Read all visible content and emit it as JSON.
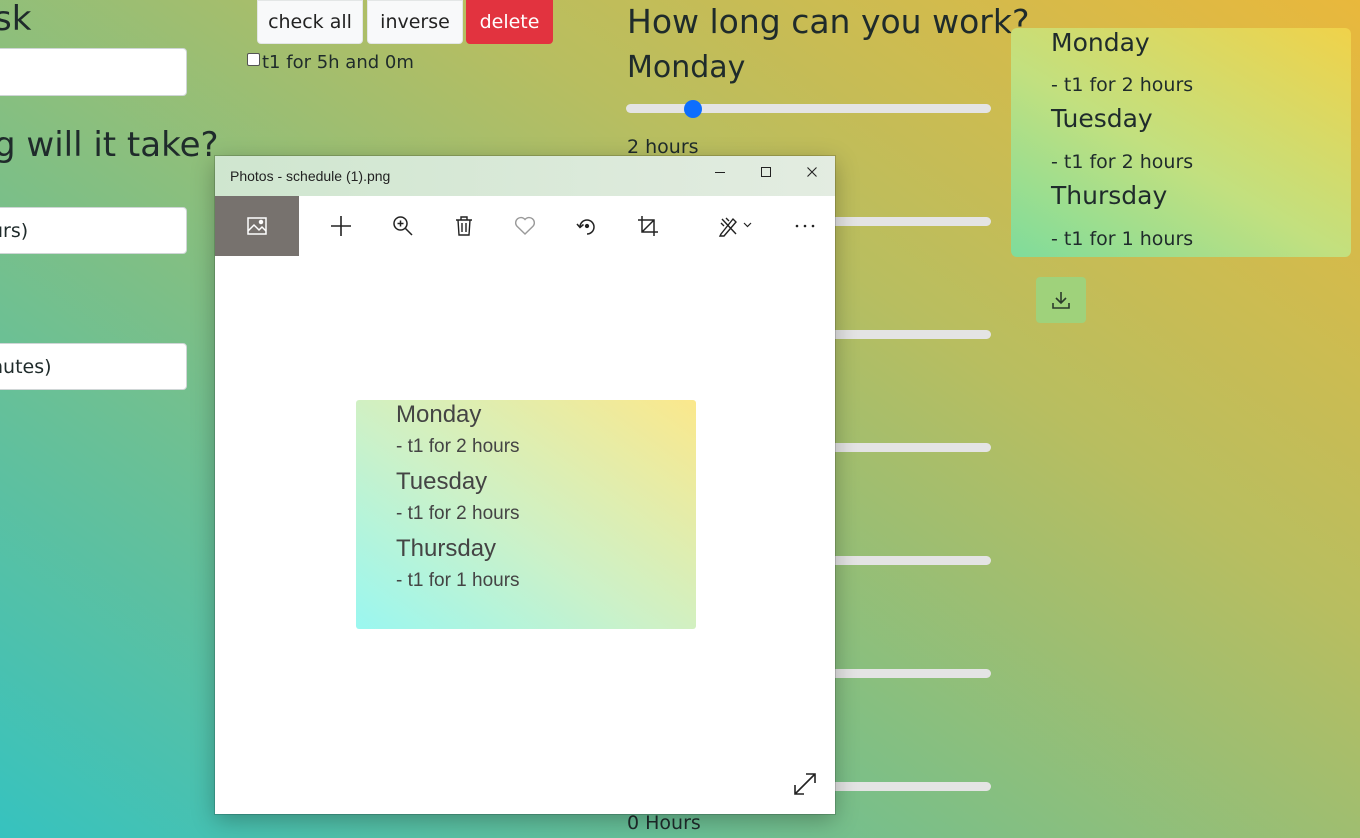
{
  "left_form": {
    "heading_task": "sk",
    "heading_duration": "g will it take?",
    "hours_field": "urs)",
    "minutes_field": "nutes)"
  },
  "task_toolbar": {
    "check_all_label": "check all",
    "inverse_label": "inverse",
    "delete_label": "delete"
  },
  "tasks": [
    {
      "label": "t1 for 5h and 0m",
      "checked": false
    }
  ],
  "availability": {
    "heading": "How long can you work?",
    "first_day": "Monday",
    "first_day_hours_label": "2 hours",
    "first_day_hours_value": 2,
    "slider_max": 12,
    "last_label": "0 Hours"
  },
  "schedule": [
    {
      "day": "Monday",
      "item": "- t1 for 2 hours"
    },
    {
      "day": "Tuesday",
      "item": "- t1 for 2 hours"
    },
    {
      "day": "Thursday",
      "item": "- t1 for 1 hours"
    }
  ],
  "photos_window": {
    "title": "Photos - schedule (1).png",
    "toolbar_icons": [
      "image-icon",
      "plus-icon",
      "zoom-in-icon",
      "trash-icon",
      "heart-icon",
      "rotate-icon",
      "crop-icon",
      "edit-icon",
      "more-icon"
    ],
    "preview": [
      {
        "day": "Monday",
        "item": "- t1 for 2 hours"
      },
      {
        "day": "Tuesday",
        "item": "- t1 for 2 hours"
      },
      {
        "day": "Thursday",
        "item": "- t1 for 1 hours"
      }
    ]
  },
  "colors": {
    "accent": "#0d6efd",
    "danger": "#e2333f"
  }
}
